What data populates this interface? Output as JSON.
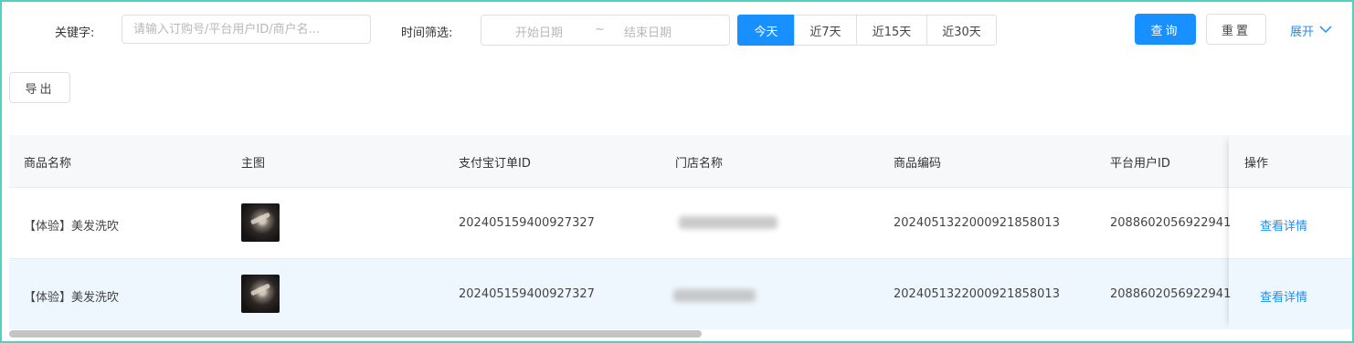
{
  "filters": {
    "keyword_label": "关键字:",
    "keyword_placeholder": "请输入订购号/平台用户ID/商户名...",
    "time_label": "时间筛选:",
    "start_date_placeholder": "开始日期",
    "range_separator": "~",
    "end_date_placeholder": "结束日期",
    "quick_ranges": [
      "今天",
      "近7天",
      "近15天",
      "近30天"
    ],
    "active_range": "今天",
    "search_label": "查询",
    "reset_label": "重置",
    "expand_label": "展开"
  },
  "export_label": "导出",
  "table": {
    "columns": [
      "商品名称",
      "主图",
      "支付宝订单ID",
      "门店名称",
      "商品编码",
      "平台用户ID",
      "操作"
    ],
    "rows": [
      {
        "product_name": "【体验】美发洗吹",
        "alipay_order_id": "202405159400927327",
        "product_code": "2024051322000921858013",
        "platform_user_id": "2088602056922941",
        "action": "查看详情"
      },
      {
        "product_name": "【体验】美发洗吹",
        "alipay_order_id": "202405159400927327",
        "product_code": "2024051322000921858013",
        "platform_user_id": "2088602056922941",
        "action": "查看详情"
      }
    ]
  },
  "colors": {
    "primary": "#1890ff",
    "frame_border": "#4fd3c0",
    "selected_row": "#eef7fe"
  },
  "icons": {
    "expand": "chevron-down-icon"
  }
}
